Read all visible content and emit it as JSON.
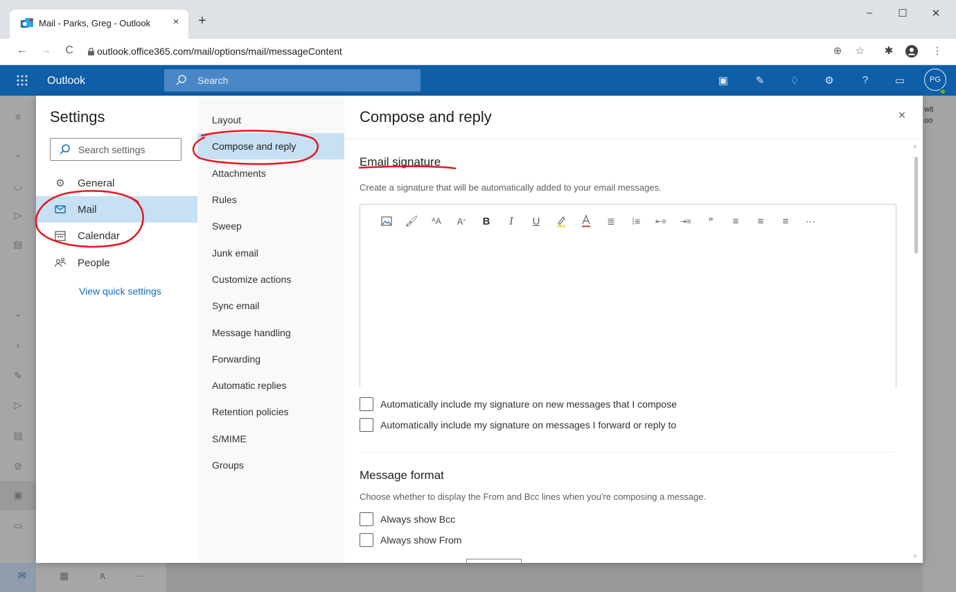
{
  "browser": {
    "tab_title": "Mail - Parks, Greg - Outlook",
    "tab_close": "×",
    "new_tab": "+",
    "url": "outlook.office365.com/mail/options/mail/messageContent",
    "window_controls": {
      "minimize": "–",
      "maximize": "☐",
      "close": "✕"
    },
    "nav": {
      "back": "←",
      "forward": "→",
      "reload": "C"
    },
    "toolbar_icons": [
      "add-icon",
      "star-icon",
      "extensions-icon",
      "profile-icon",
      "menu-icon"
    ]
  },
  "outlook": {
    "app_name": "Outlook",
    "search_placeholder": "Search",
    "avatar_initials": "PG",
    "header_icons": [
      "teams-icon",
      "todo-icon",
      "bell-icon",
      "gear-icon",
      "help-icon",
      "feedback-icon"
    ]
  },
  "background": {
    "right_text_lines": [
      "wit",
      "oo"
    ],
    "bottom_more": "···"
  },
  "settings": {
    "title": "Settings",
    "search_placeholder": "Search settings",
    "categories": [
      {
        "label": "General",
        "icon": "gear-icon",
        "selected": false
      },
      {
        "label": "Mail",
        "icon": "mail-icon",
        "selected": true
      },
      {
        "label": "Calendar",
        "icon": "calendar-icon",
        "selected": false
      },
      {
        "label": "People",
        "icon": "people-icon",
        "selected": false
      }
    ],
    "quick_settings_link": "View quick settings",
    "subcategories": [
      {
        "label": "Layout",
        "selected": false
      },
      {
        "label": "Compose and reply",
        "selected": true
      },
      {
        "label": "Attachments",
        "selected": false
      },
      {
        "label": "Rules",
        "selected": false
      },
      {
        "label": "Sweep",
        "selected": false
      },
      {
        "label": "Junk email",
        "selected": false
      },
      {
        "label": "Customize actions",
        "selected": false
      },
      {
        "label": "Sync email",
        "selected": false
      },
      {
        "label": "Message handling",
        "selected": false
      },
      {
        "label": "Forwarding",
        "selected": false
      },
      {
        "label": "Automatic replies",
        "selected": false
      },
      {
        "label": "Retention policies",
        "selected": false
      },
      {
        "label": "S/MIME",
        "selected": false
      },
      {
        "label": "Groups",
        "selected": false
      }
    ]
  },
  "pane": {
    "title": "Compose and reply",
    "close": "×",
    "email_signature": {
      "heading": "Email signature",
      "description": "Create a signature that will be automatically added to your email messages.",
      "toolbar_more": "···",
      "checkboxes": [
        {
          "label": "Automatically include my signature on new messages that I compose",
          "checked": false
        },
        {
          "label": "Automatically include my signature on messages I forward or reply to",
          "checked": false
        }
      ]
    },
    "message_format": {
      "heading": "Message format",
      "description": "Choose whether to display the From and Bcc lines when you're composing a message.",
      "checkboxes": [
        {
          "label": "Always show Bcc",
          "checked": false
        },
        {
          "label": "Always show From",
          "checked": false
        }
      ]
    }
  },
  "colors": {
    "outlook_blue": "#0f5ea8",
    "selection": "#c7e0f4",
    "link": "#106ebe",
    "annotation_red": "#e8141c"
  }
}
